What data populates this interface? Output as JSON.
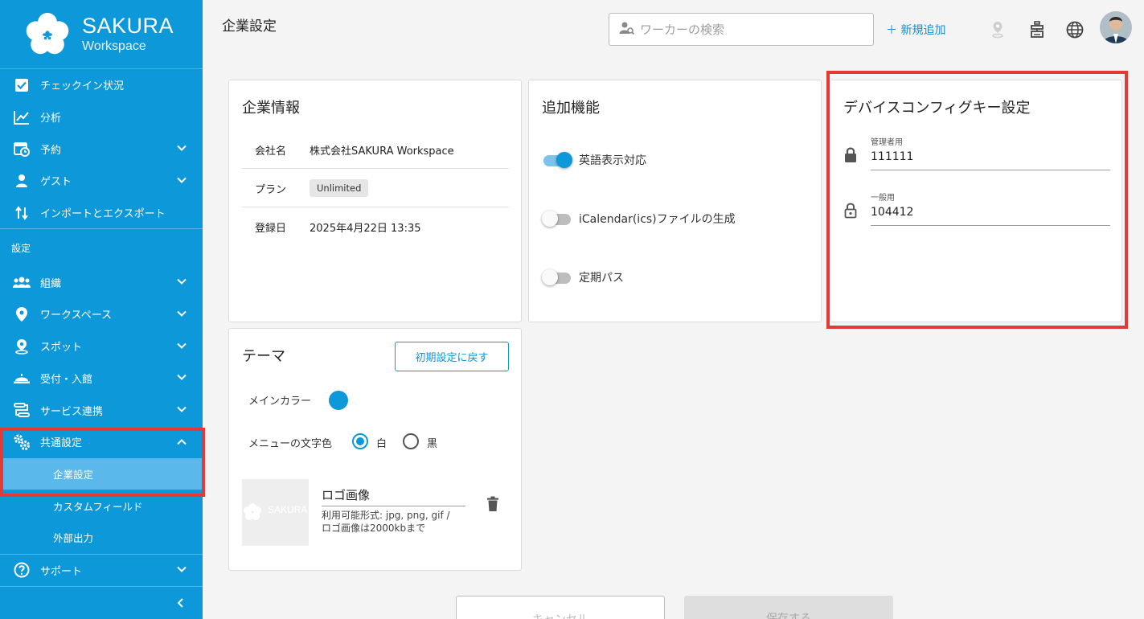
{
  "brand": {
    "name": "SAKURA",
    "sub": "Workspace"
  },
  "sidebar": {
    "items": [
      {
        "label": "チェックイン状況",
        "icon": "checkbox-icon"
      },
      {
        "label": "分析",
        "icon": "chart-icon"
      },
      {
        "label": "予約",
        "icon": "calendar-clock-icon"
      },
      {
        "label": "ゲスト",
        "icon": "guest-icon"
      },
      {
        "label": "インポートとエクスポート",
        "icon": "import-export-icon"
      }
    ],
    "section_label": "設定",
    "settings_items": [
      {
        "label": "組織",
        "icon": "people-icon"
      },
      {
        "label": "ワークスペース",
        "icon": "location-pin-icon"
      },
      {
        "label": "スポット",
        "icon": "spot-pin-icon"
      },
      {
        "label": "受付・入館",
        "icon": "reception-bell-icon"
      },
      {
        "label": "サービス連携",
        "icon": "integration-icon"
      },
      {
        "label": "共通設定",
        "icon": "gears-icon"
      }
    ],
    "sub_items": [
      {
        "label": "企業設定",
        "active": true
      },
      {
        "label": "カスタムフィールド",
        "active": false
      },
      {
        "label": "外部出力",
        "active": false
      }
    ],
    "support": {
      "label": "サポート",
      "icon": "help-circle-icon"
    }
  },
  "header": {
    "title": "企業設定",
    "search_placeholder": "ワーカーの検索",
    "add_new": "＋ 新規追加"
  },
  "company_info": {
    "title": "企業情報",
    "rows": [
      {
        "key": "会社名",
        "value": "株式会社SAKURA Workspace"
      },
      {
        "key": "プラン",
        "value": "Unlimited"
      },
      {
        "key": "登録日",
        "value": "2025年4月22日 13:35"
      }
    ]
  },
  "features": {
    "title": "追加機能",
    "toggles": [
      {
        "label": "英語表示対応",
        "on": true
      },
      {
        "label": "iCalendar(ics)ファイルの生成",
        "on": false
      },
      {
        "label": "定期パス",
        "on": false
      }
    ]
  },
  "device_keys": {
    "title": "デバイスコンフィグキー設定",
    "admin": {
      "label": "管理者用",
      "value": "111111"
    },
    "general": {
      "label": "一般用",
      "value": "104412"
    }
  },
  "theme": {
    "title": "テーマ",
    "reset_button": "初期設定に戻す",
    "main_color_label": "メインカラー",
    "main_color": "#0d98d9",
    "menu_text_color_label": "メニューの文字色",
    "option_white": "白",
    "option_black": "黒",
    "selected": "白",
    "logo_title": "ロゴ画像",
    "logo_hint_1": "利用可能形式: jpg, png, gif /",
    "logo_hint_2": "ロゴ画像は2000kbまで",
    "logo_watermark": "SAKURA"
  },
  "footer": {
    "cancel": "キャンセル",
    "save": "保存する"
  },
  "colors": {
    "sidebar": "#0d98d9",
    "active_sub": "#5ab8ea",
    "highlight": "#e53935",
    "accent": "#1a8fd1"
  }
}
